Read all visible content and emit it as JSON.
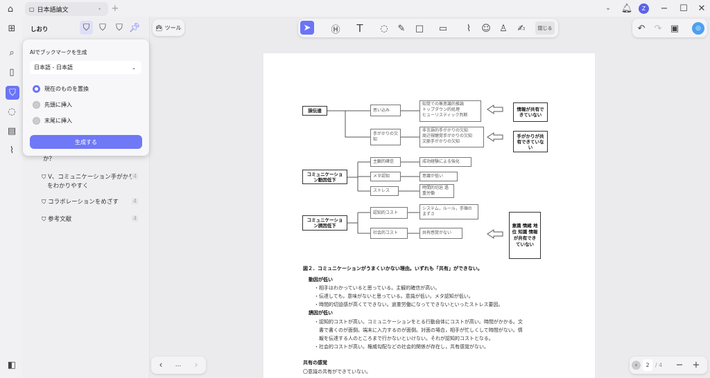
{
  "titlebar": {
    "tab_title": "日本語論文",
    "avatar_letter": "Z"
  },
  "sidebar": {
    "title": "しおり",
    "tools_label": "ツール",
    "items": [
      {
        "label": "か？",
        "page": ""
      },
      {
        "label": "V、コミュニケーション手がかり",
        "label2": "をわかりやすく",
        "page": "4"
      },
      {
        "label": "コラボレーションをめざす",
        "page": "4"
      },
      {
        "label": "参考文献",
        "page": "4"
      }
    ]
  },
  "popup": {
    "title": "AIでブックマークを生成",
    "language": "日本語 - 日本語",
    "options": [
      "現在のものを置換",
      "先頭に挿入",
      "末尾に挿入"
    ],
    "selected": 0,
    "generate_label": "生成する"
  },
  "toolbar": {
    "close_label": "閉じる"
  },
  "pager": {
    "current": "2",
    "total": "/ 4",
    "more": "..."
  },
  "diagram": {
    "misdelivery": "誤伝達",
    "omoikomi": "思い込み",
    "b1": [
      "知覚での無意識的推論",
      "トップダウン的処理",
      "ヒューリスティック判断"
    ],
    "r1": "情報が共有できていない",
    "cue": "手がかりの欠知",
    "b2": [
      "非言語的手がかりの欠知",
      "周辺視聴覚手がかりの欠知",
      "文脈手がかりの欠知"
    ],
    "r2": "手がかりが共有できていない",
    "motive": "コミュニケーション動因低下",
    "m1": "主観的確信",
    "m1r": "成功経験による強化",
    "m2": "メタ認知",
    "m2r": "意識が低い",
    "m3": "ストレス",
    "m3r": "時間的切迫 過重労働",
    "incentive": "コミュニケーション誘因低下",
    "i1": "認知的コスト",
    "i1r": "システム，ルール，手順のまずさ",
    "i2": "社会的コスト",
    "i2r": "共有感覚がない",
    "r3": "意識 情緒 地位 知識 情報 が共有できていない"
  },
  "body": {
    "caption": "図２．コミュニケーションがうまくいかない理由。いずれも「共有」ができない。",
    "h1": "動因が低い",
    "l1": [
      "・相手はわかっていると思っている。主観的確信が高い。",
      "・伝達しても，意味がないと思っている。意識が低い。メタ認知が低い。",
      "・時間的切迫感が高くてできない。過重労働になってできないといったストレス要因。"
    ],
    "h2": "誘因が低い",
    "l2": [
      "・認知的コストが高い。コミュニケーションをとる行動自体にコストが高い。時間がかかる。文",
      "　書で書くのが面倒。端末に入力するのが面倒。対面の場合，相手が忙しくして時間がない。情",
      "　報を伝達する人のところまで行かないといけない。それが認知的コストとなる。",
      "・社会的コストが高い。権威勾配などの社会的関係が存在し，共有感覚がない。"
    ],
    "h3": "共有の感覚",
    "l3": "〇意識の共有ができていない。"
  },
  "colors": {
    "accent": "#6b74f5"
  }
}
